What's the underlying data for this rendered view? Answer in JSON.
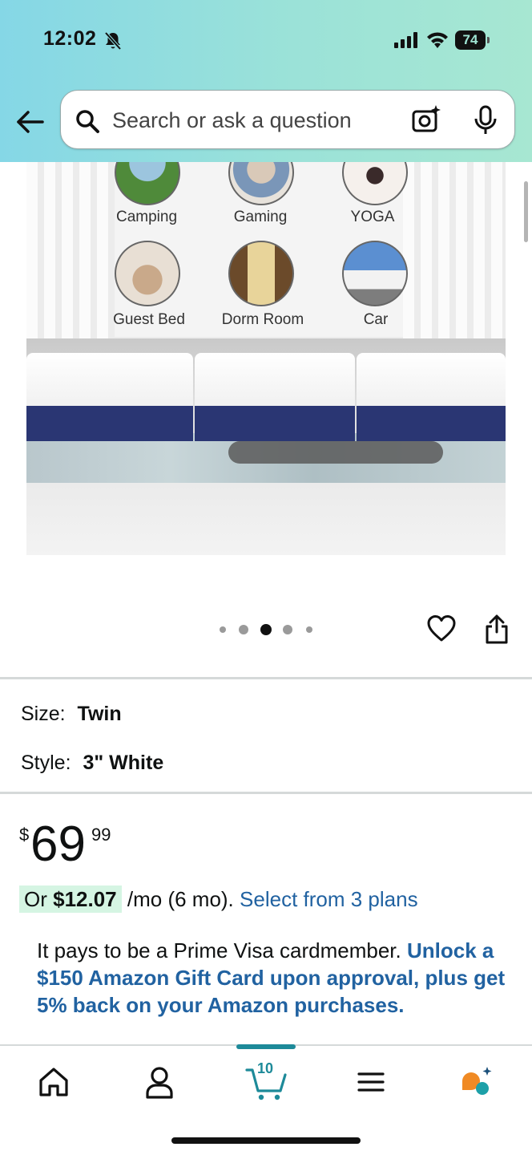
{
  "status_bar": {
    "time": "12:02",
    "battery": "74"
  },
  "header": {
    "search_placeholder": "Search or ask a question"
  },
  "product_image": {
    "usages": [
      {
        "label": "Camping"
      },
      {
        "label": "Gaming"
      },
      {
        "label": "YOGA"
      },
      {
        "label": "Guest Bed"
      },
      {
        "label": "Dorm Room"
      },
      {
        "label": "Car"
      }
    ]
  },
  "carousel": {
    "count": 5,
    "active_index": 2
  },
  "options": {
    "size_label": "Size:",
    "size_value": "Twin",
    "style_label": "Style:",
    "style_value": "3\" White"
  },
  "price": {
    "symbol": "$",
    "whole": "69",
    "fraction": "99"
  },
  "installment": {
    "prefix": "Or ",
    "amount": "$12.07",
    "term": "/mo (6 mo).",
    "link": "Select from 3 plans"
  },
  "promo": {
    "text": "It pays to be a Prime Visa cardmember.",
    "link": "Unlock a $150 Amazon Gift Card upon approval, plus get 5% back on your Amazon purchases."
  },
  "bottom_nav": {
    "cart_count": "10"
  },
  "colors": {
    "link": "#2162a1",
    "accent": "#1d8a99",
    "installment_highlight": "#d5f5e3",
    "mattress_side": "#2a3673"
  }
}
